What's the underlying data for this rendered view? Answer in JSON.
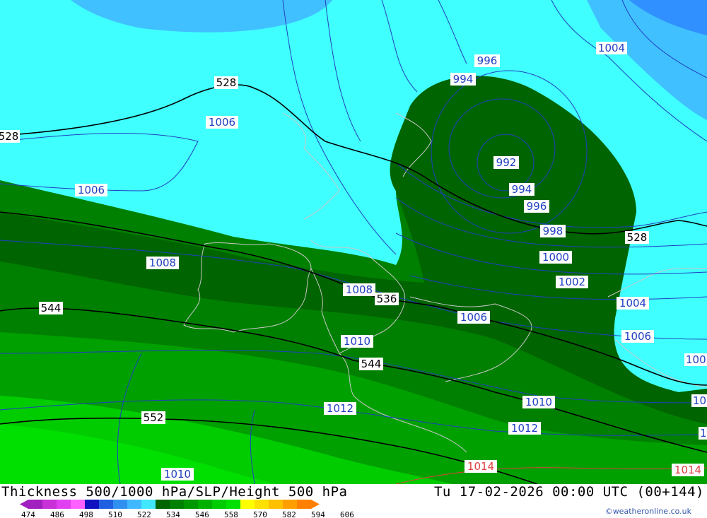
{
  "title": "Thickness 500/1000 hPa/SLP/Height 500 hPa",
  "valid_time": "Tu 17-02-2026 00:00 UTC (00+144)",
  "credit": "©weatheronline.co.uk",
  "legend": {
    "labels": [
      "474",
      "486",
      "498",
      "510",
      "522",
      "534",
      "546",
      "558",
      "570",
      "582",
      "594",
      "606"
    ],
    "colors": [
      "#a020c0",
      "#c830d8",
      "#e040f0",
      "#ff60ff",
      "#1010c0",
      "#2060e0",
      "#3090f0",
      "#40b8ff",
      "#40e8ff",
      "#006400",
      "#008000",
      "#009800",
      "#00b000",
      "#00cc00",
      "#00e000",
      "#ffff00",
      "#ffe000",
      "#ffc000",
      "#ffa000",
      "#ff8000"
    ]
  },
  "thickness_labels": [
    {
      "text": "528",
      "color": "black"
    },
    {
      "text": "528",
      "color": "black"
    },
    {
      "text": "528",
      "color": "black"
    },
    {
      "text": "536",
      "color": "green"
    },
    {
      "text": "544",
      "color": "black"
    },
    {
      "text": "544",
      "color": "black"
    },
    {
      "text": "552",
      "color": "black"
    }
  ],
  "slp_labels": [
    "1004",
    "996",
    "994",
    "992",
    "994",
    "996",
    "998",
    "1000",
    "1002",
    "1004",
    "1006",
    "1006",
    "1006",
    "1006",
    "1008",
    "1008",
    "1010",
    "1010",
    "1010",
    "1010",
    "1012",
    "1012",
    "1014",
    "1014",
    "100",
    "10",
    "1"
  ],
  "colors": {
    "cyan": "#40ffff",
    "light_blue": "#40c0ff",
    "blue": "#3aa0ff",
    "dark_green": "#006400",
    "green": "#008000",
    "isobar": "#2040c0",
    "thickness": "#000000",
    "coast": "#c8c8c8",
    "hi_isobar": "#e04040"
  }
}
